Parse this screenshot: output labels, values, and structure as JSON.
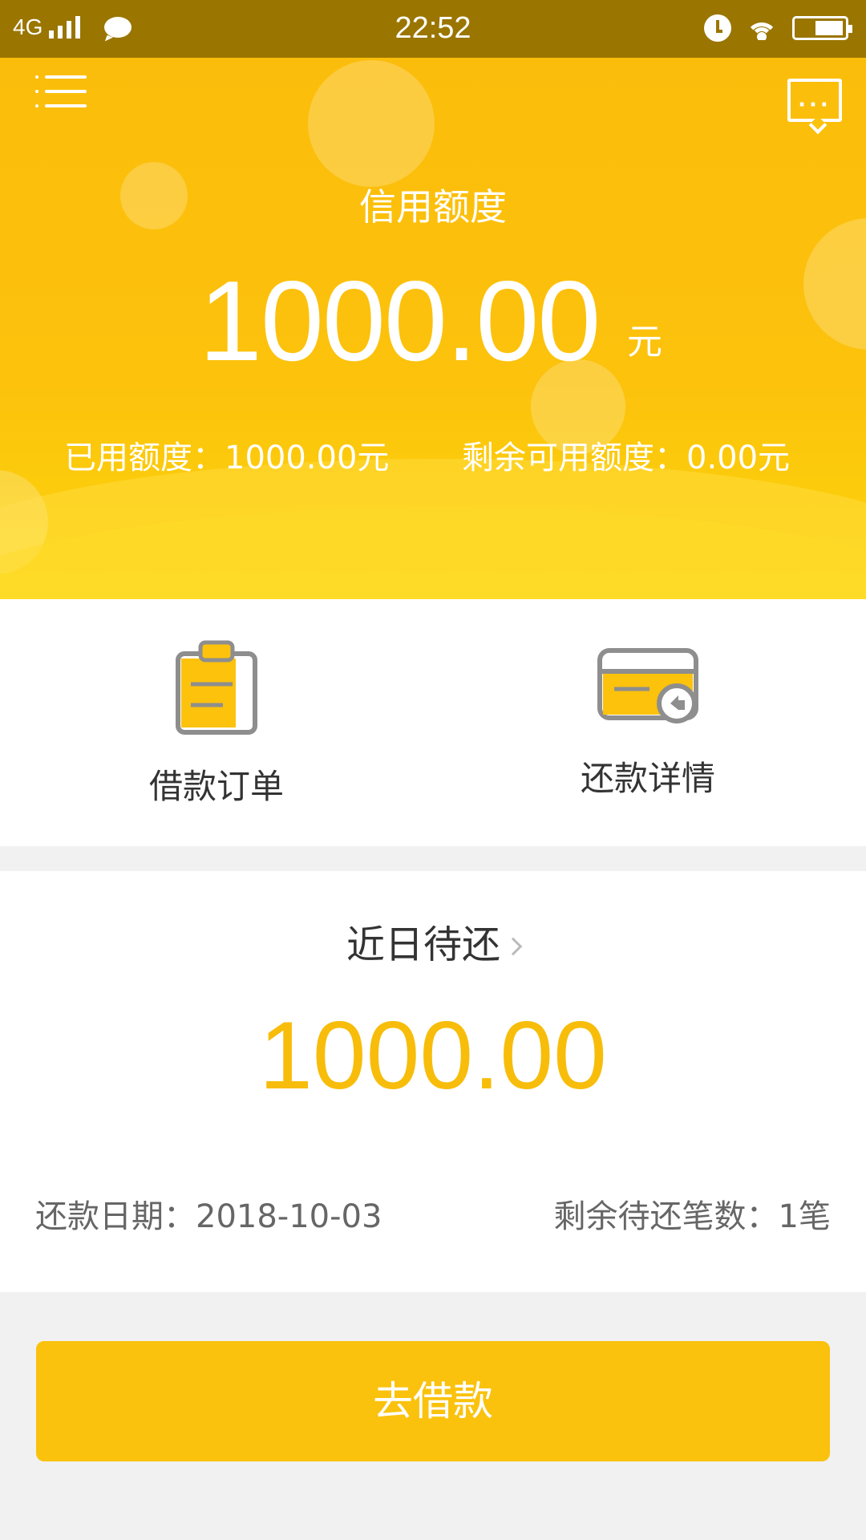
{
  "status_bar": {
    "network": "4G",
    "time": "22:52",
    "icons": [
      "signal-icon",
      "message-icon",
      "alarm-icon",
      "wifi-icon",
      "battery-icon"
    ]
  },
  "header": {
    "menu_icon": "menu-icon",
    "message_icon": "message-icon",
    "credit_title": "信用额度",
    "credit_amount": "1000.00",
    "credit_unit": "元",
    "used_text": "已用额度：1000.00元",
    "remaining_text": "剩余可用额度：0.00元",
    "colors": {
      "primary": "#fcc20c",
      "status_bar": "#9a7500"
    }
  },
  "actions": [
    {
      "label": "借款订单",
      "icon": "clipboard-icon"
    },
    {
      "label": "还款详情",
      "icon": "card-repay-icon"
    }
  ],
  "recent_due": {
    "title": "近日待还",
    "amount": "1000.00",
    "due_date": "还款日期：2018-10-03",
    "remaining_count": "剩余待还笔数：1笔",
    "accent": "#f7bd0a"
  },
  "button": {
    "label": "去借款",
    "color": "#fac20d"
  }
}
